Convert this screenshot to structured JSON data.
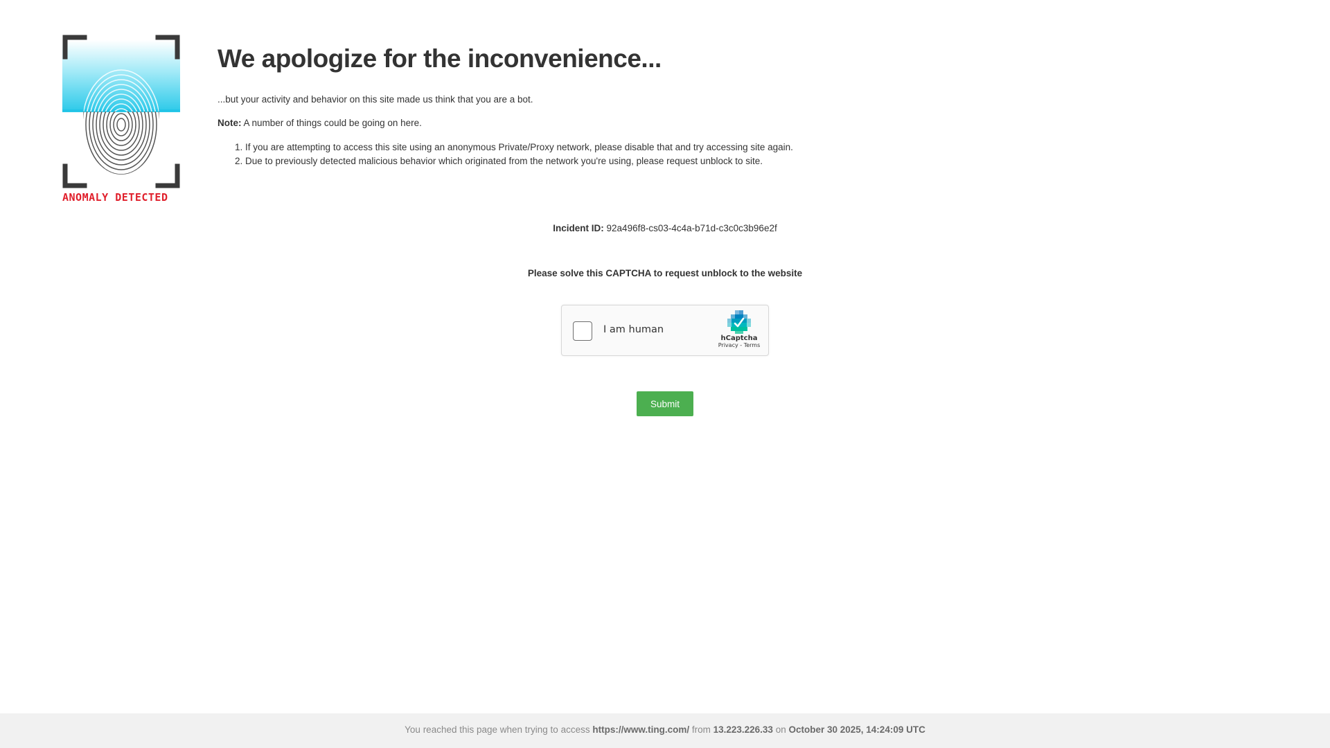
{
  "logo": {
    "caption": "ANOMALY DETECTED",
    "icon": "fingerprint-scan-icon",
    "colors": {
      "frame": "#3a3a3a",
      "scan": "#29c9e8",
      "caption": "#e0202c"
    }
  },
  "main": {
    "headline": "We apologize for the inconvenience...",
    "intro": "...but your activity and behavior on this site made us think that you are a bot.",
    "note_label": "Note:",
    "note_text": " A number of things could be going on here.",
    "reasons": [
      "If you are attempting to access this site using an anonymous Private/Proxy network, please disable that and try accessing site again.",
      "Due to previously detected malicious behavior which originated from the network you're using, please request unblock to site."
    ]
  },
  "incident": {
    "label": "Incident ID:",
    "value": " 92a496f8-cs03-4c4a-b71d-c3c0c3b96e2f"
  },
  "captcha": {
    "prompt": "Please solve this CAPTCHA to request unblock to the website",
    "checkbox_label": "I am human",
    "brand": "hCaptcha",
    "privacy_link": "Privacy",
    "separator": " - ",
    "terms_link": "Terms"
  },
  "submit_label": "Submit",
  "footer": {
    "prefix": "You reached this page when trying to access ",
    "url": "https://www.ting.com/",
    "from_text": " from ",
    "ip": "13.223.226.33",
    "on_text": " on ",
    "datetime": "October 30 2025, 14:24:09 UTC"
  },
  "colors": {
    "submit": "#4caf50",
    "footer_bg": "#f1f1f1",
    "text": "#333333"
  }
}
